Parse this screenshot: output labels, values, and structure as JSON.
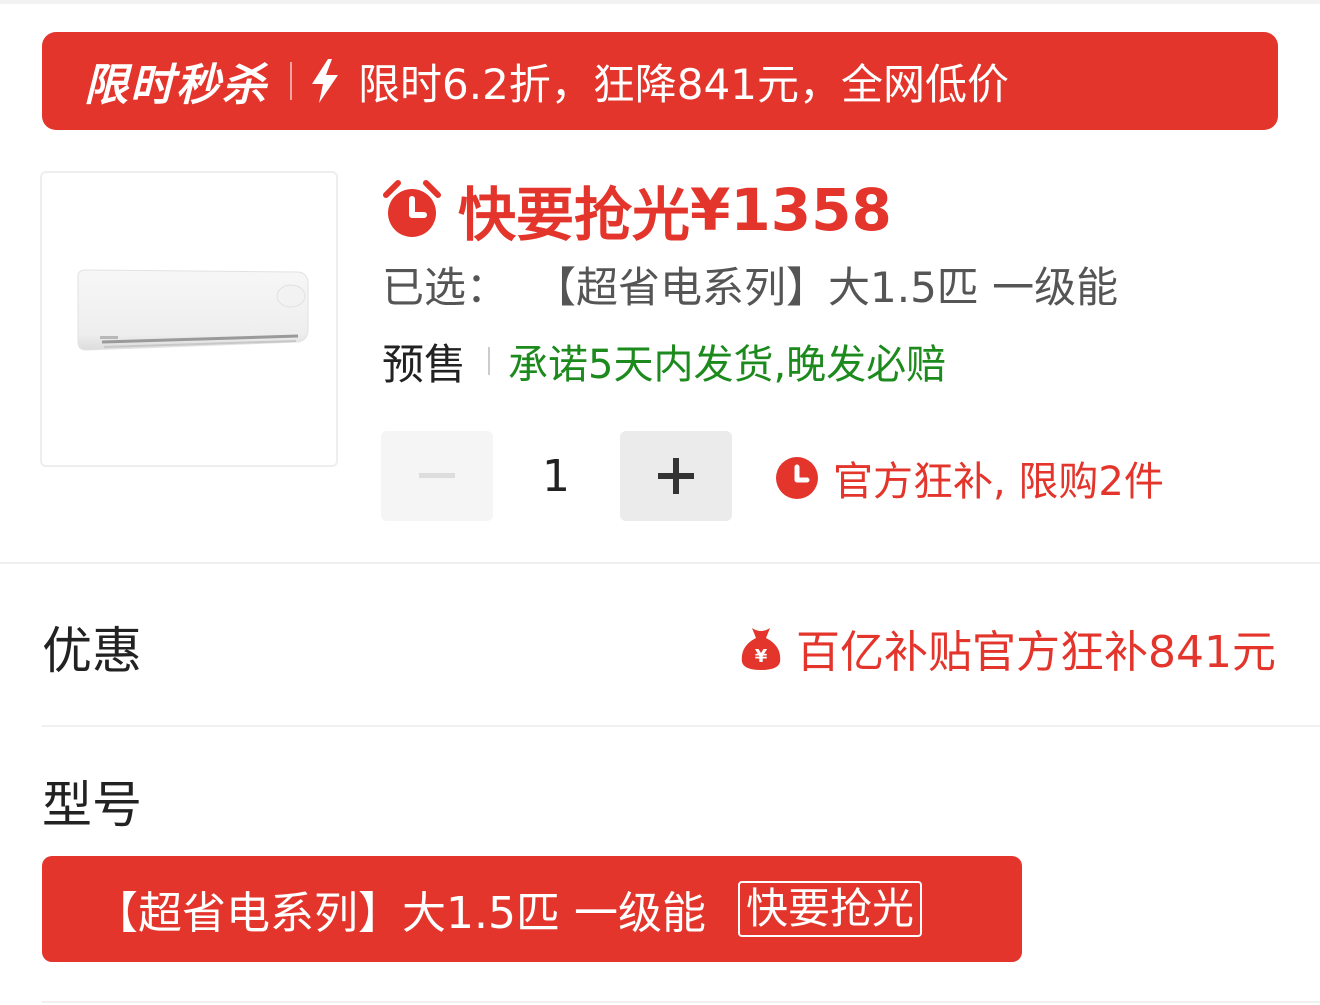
{
  "flash_sale": {
    "title": "限时秒杀",
    "text": "限时6.2折，狂降841元，全网低价"
  },
  "product": {
    "price_label": "快要抢光",
    "price": "¥1358",
    "selected_label": "已选：",
    "selected_value": "【超省电系列】大1.5匹 一级能",
    "presale_label": "预售",
    "presale_promise": "承诺5天内发货,晚发必赔",
    "quantity": "1",
    "limit_text": "官方狂补, 限购2件"
  },
  "discount": {
    "label": "优惠",
    "value": "百亿补贴官方狂补841元"
  },
  "model": {
    "label": "型号",
    "options": [
      {
        "label": "【超省电系列】大1.5匹 一级能",
        "badge": "快要抢光",
        "selected": true
      }
    ]
  },
  "colors": {
    "accent": "#e3352b",
    "promise_green": "#1d8a1d"
  },
  "icons": {
    "flash": "lightning-bolt",
    "price": "alarm-clock",
    "limit": "clock",
    "discount": "money-bag"
  }
}
